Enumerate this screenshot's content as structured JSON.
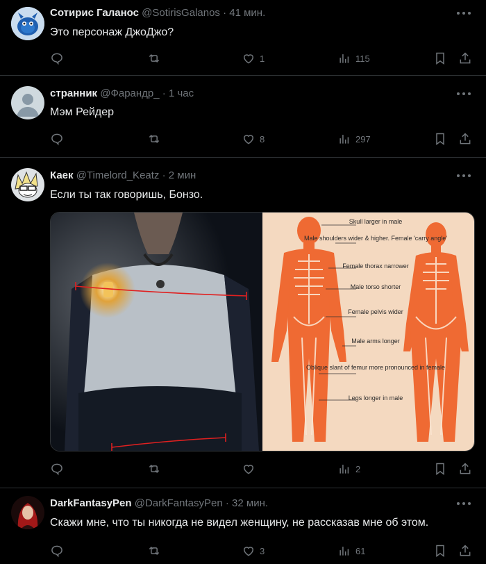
{
  "posts": [
    {
      "name": "Сотирис Галанос",
      "handle": "@SotirisGalanos",
      "sep": "·",
      "time": "41 мин.",
      "text": "Это персонаж ДжоДжо?",
      "stats": {
        "reply": "",
        "retweet": "",
        "like": "1",
        "views": "115"
      }
    },
    {
      "name": "странник",
      "handle": "@Фарандр_",
      "sep": "·",
      "time": "1 час",
      "text": "Мэм Рейдер",
      "stats": {
        "reply": "",
        "retweet": "",
        "like": "8",
        "views": "297"
      }
    },
    {
      "name": "Каек",
      "handle": "@Timelord_Keatz",
      "sep": "·",
      "time": "2 мин",
      "text": "Если ты так говоришь, Бонзо.",
      "stats": {
        "reply": "",
        "retweet": "",
        "like": "",
        "views": "2"
      }
    },
    {
      "name": "DarkFantasyPen",
      "handle": "@DarkFantasyPen",
      "sep": "·",
      "time": "32 мин.",
      "text": "Скажи мне, что ты никогда не видел женщину, не рассказав мне об этом.",
      "stats": {
        "reply": "",
        "retweet": "",
        "like": "3",
        "views": "61"
      }
    }
  ],
  "diagram_labels": [
    "Skull larger in male",
    "Male shoulders wider & higher. Female 'carry angle'",
    "Female thorax narrower",
    "Male torso shorter",
    "Female pelvis wider",
    "Male arms longer",
    "Oblique slant of femur more pronounced in female",
    "Legs longer in male"
  ],
  "colors": {
    "background": "#000000",
    "text": "#e7e9ea",
    "muted": "#71767b",
    "divider": "#2f3336",
    "diagram_bg": "#f4d9c0",
    "body_orange": "#ef6a33"
  }
}
